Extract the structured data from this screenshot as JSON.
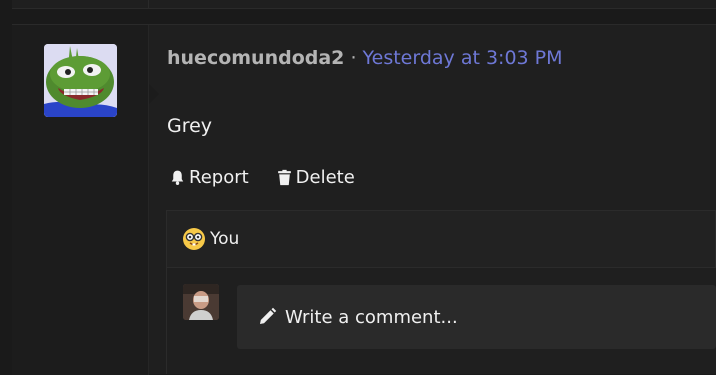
{
  "post": {
    "username": "huecomundoda2",
    "separator": "·",
    "timestamp": "Yesterday at 3:03 PM",
    "body": "Grey"
  },
  "actions": {
    "report_label": "Report",
    "delete_label": "Delete"
  },
  "reactions": {
    "who": "You",
    "emoji_icon": "nerd-face-icon"
  },
  "comment_input": {
    "placeholder": "Write a comment..."
  },
  "colors": {
    "background": "#1a1a1a",
    "username": "#b4b4b4",
    "timestamp": "#6e78d6",
    "text": "#f0f0f0"
  }
}
